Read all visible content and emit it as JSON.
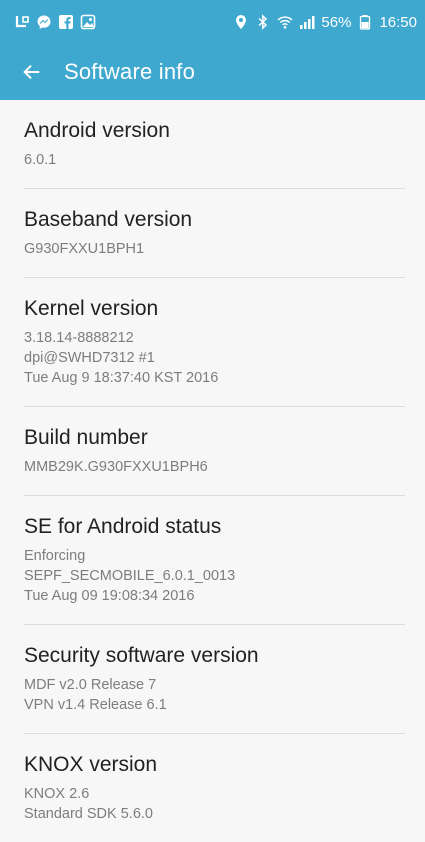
{
  "status": {
    "battery": "56%",
    "time": "16:50",
    "icons_left": [
      "lg-icon",
      "messenger-icon",
      "facebook-icon",
      "gallery-icon"
    ],
    "icons_right": [
      "location-pin-icon",
      "bluetooth-icon",
      "wifi-icon",
      "signal-icon",
      "battery-icon"
    ]
  },
  "header": {
    "title": "Software info"
  },
  "items": [
    {
      "title": "Android version",
      "lines": [
        "6.0.1"
      ]
    },
    {
      "title": "Baseband version",
      "lines": [
        "G930FXXU1BPH1"
      ]
    },
    {
      "title": "Kernel version",
      "lines": [
        "3.18.14-8888212",
        "dpi@SWHD7312 #1",
        "Tue Aug 9 18:37:40 KST 2016"
      ]
    },
    {
      "title": "Build number",
      "lines": [
        "MMB29K.G930FXXU1BPH6"
      ]
    },
    {
      "title": "SE for Android status",
      "lines": [
        "Enforcing",
        "SEPF_SECMOBILE_6.0.1_0013",
        "Tue Aug 09 19:08:34 2016"
      ]
    },
    {
      "title": "Security software version",
      "lines": [
        "MDF v2.0 Release 7",
        "VPN v1.4 Release 6.1"
      ]
    },
    {
      "title": "KNOX version",
      "lines": [
        "KNOX 2.6",
        "Standard SDK 5.6.0"
      ]
    }
  ],
  "colors": {
    "accent": "#3ea8cf",
    "background": "#f7f7f7"
  }
}
